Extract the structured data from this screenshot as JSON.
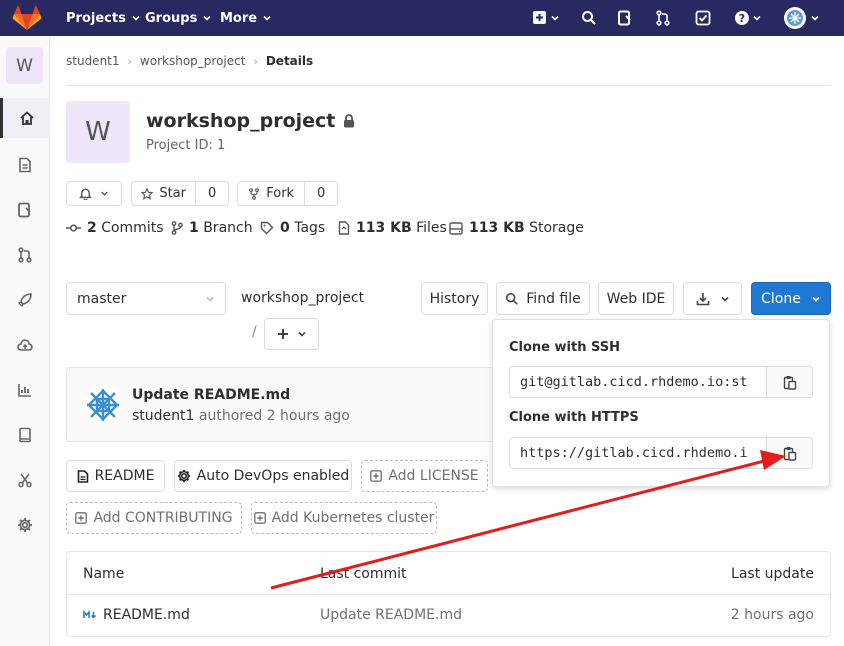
{
  "topbar": {
    "nav": [
      {
        "label": "Projects"
      },
      {
        "label": "Groups"
      },
      {
        "label": "More"
      }
    ],
    "icons": [
      "plus-icon",
      "search-icon",
      "issues-icon",
      "merge-request-icon",
      "todo-icon",
      "help-icon",
      "avatar"
    ]
  },
  "sidebar": {
    "avatar_letter": "W",
    "items": [
      "home-icon",
      "repository-icon",
      "issues-icon",
      "merge-request-icon",
      "rocket-icon",
      "cloud-icon",
      "analytics-icon",
      "wiki-icon",
      "snippets-icon",
      "settings-icon"
    ]
  },
  "breadcrumb": {
    "items": [
      "student1",
      "workshop_project",
      "Details"
    ]
  },
  "project": {
    "avatar_letter": "W",
    "name": "workshop_project",
    "id_label": "Project ID: 1"
  },
  "actions": {
    "star_label": "Star",
    "star_count": "0",
    "fork_label": "Fork",
    "fork_count": "0"
  },
  "stats": {
    "commits_num": "2",
    "commits_label": "Commits",
    "branch_num": "1",
    "branch_label": "Branch",
    "tags_num": "0",
    "tags_label": "Tags",
    "files_num": "113 KB",
    "files_label": "Files",
    "storage_num": "113 KB",
    "storage_label": "Storage"
  },
  "repo_bar": {
    "branch": "master",
    "path": "workshop_project",
    "path_sep": "/",
    "history": "History",
    "find_file": "Find file",
    "web_ide": "Web IDE",
    "clone": "Clone"
  },
  "clone_dropdown": {
    "ssh_label": "Clone with SSH",
    "ssh_url": "git@gitlab.cicd.rhdemo.io:st",
    "https_label": "Clone with HTTPS",
    "https_url": "https://gitlab.cicd.rhdemo.i"
  },
  "last_commit": {
    "message": "Update README.md",
    "author": "student1",
    "authored": "authored",
    "time": "2 hours ago"
  },
  "quick_buttons": {
    "readme": "README",
    "autodevops": "Auto DevOps enabled",
    "add_license": "Add LICENSE",
    "add_contributing": "Add CONTRIBUTING",
    "add_k8s": "Add Kubernetes cluster"
  },
  "files_table": {
    "headers": [
      "Name",
      "Last commit",
      "Last update"
    ],
    "rows": [
      {
        "name": "README.md",
        "commit": "Update README.md",
        "updated": "2 hours ago"
      }
    ]
  },
  "colors": {
    "topbar": "#292961",
    "clone_button": "#1f78d1",
    "annotation_arrow": "#e51c1c"
  }
}
